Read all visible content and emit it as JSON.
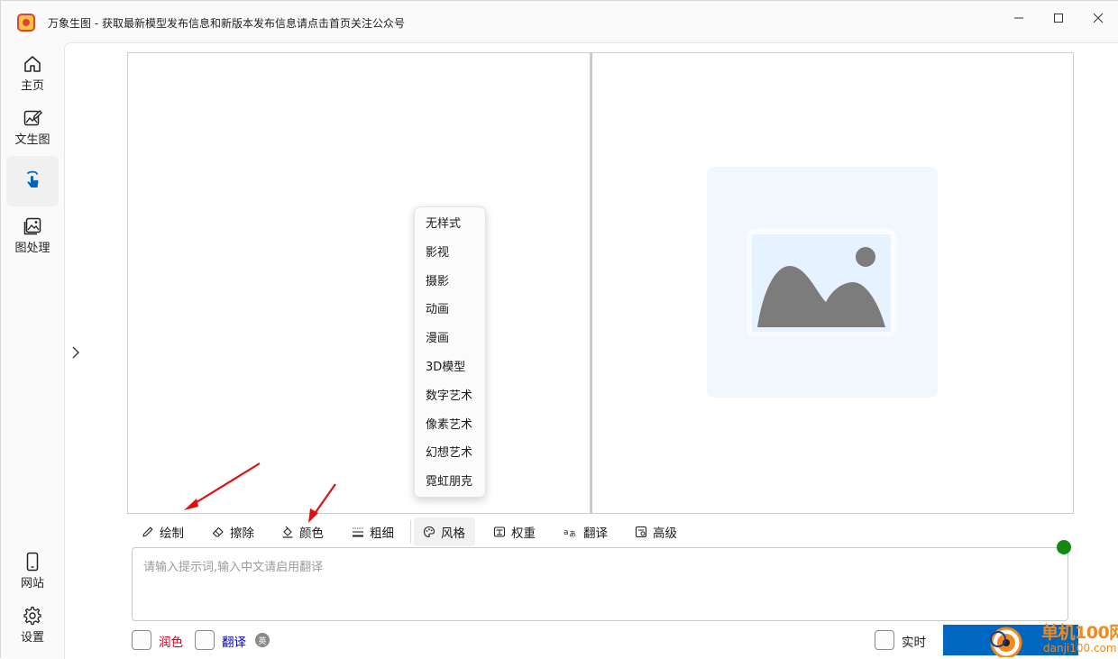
{
  "window": {
    "title": "万象生图 - 获取最新模型发布信息和新版本发布信息请点击首页关注公众号"
  },
  "sidebar": {
    "items": [
      {
        "label": "主页",
        "icon": "home-icon"
      },
      {
        "label": "文生图",
        "icon": "image-edit-icon"
      },
      {
        "label": "",
        "icon": "hand-pointer-icon",
        "active": true
      },
      {
        "label": "图处理",
        "icon": "image-stack-icon"
      },
      {
        "label": "网站",
        "icon": "phone-icon"
      },
      {
        "label": "设置",
        "icon": "gear-icon"
      }
    ]
  },
  "style_menu": {
    "items": [
      "无样式",
      "影视",
      "摄影",
      "动画",
      "漫画",
      "3D模型",
      "数字艺术",
      "像素艺术",
      "幻想艺术",
      "霓虹朋克"
    ]
  },
  "toolbar": {
    "draw": "绘制",
    "erase": "擦除",
    "color": "颜色",
    "thickness": "粗细",
    "style": "风格",
    "weight": "权重",
    "translate": "翻译",
    "advanced": "高级"
  },
  "prompt": {
    "placeholder": "请输入提示词,输入中文请启用翻译",
    "value": ""
  },
  "options": {
    "polish": "润色",
    "translate": "翻译",
    "lang_badge": "英",
    "realtime": "实时"
  },
  "colors": {
    "accent": "#0067c0",
    "status_online": "#128a12",
    "polish_label": "#d0021b",
    "translate_label": "#0000cc",
    "watermark": "#f08a1e"
  },
  "watermark": {
    "line1": "单机100网",
    "line2": "danji100.com"
  }
}
